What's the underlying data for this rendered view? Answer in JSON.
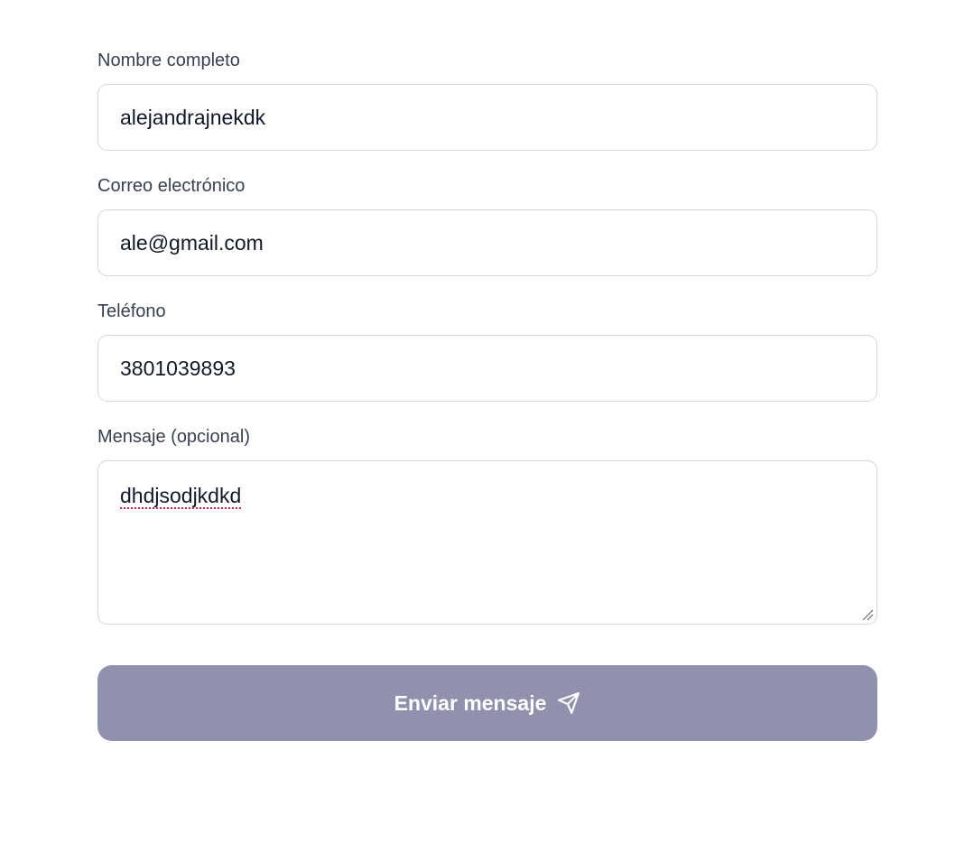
{
  "form": {
    "fields": [
      {
        "label": "Nombre completo",
        "value": "alejandrajnekdk"
      },
      {
        "label": "Correo electrónico",
        "value": "ale@gmail.com"
      },
      {
        "label": "Teléfono",
        "value": "3801039893"
      }
    ],
    "message": {
      "label": "Mensaje (opcional)",
      "value": "dhdjsodjkdkd"
    },
    "submit_label": "Enviar mensaje",
    "submit_icon": "send-icon"
  },
  "colors": {
    "button_bg": "#9091ac",
    "border": "#d1d5db",
    "label": "#374151",
    "text": "#111827",
    "spellcheck_underline": "#e11d48"
  }
}
